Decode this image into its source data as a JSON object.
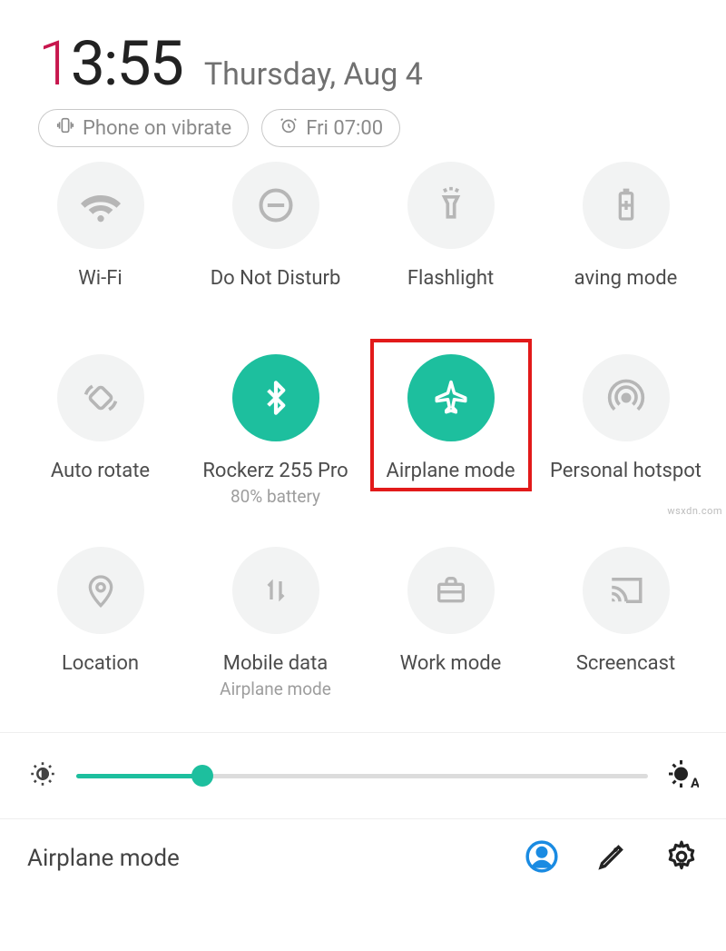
{
  "header": {
    "clock_first": "1",
    "clock_rest": "3:55",
    "date": "Thursday, Aug 4"
  },
  "chips": {
    "vibrate": "Phone on vibrate",
    "alarm": "Fri 07:00"
  },
  "tiles": [
    {
      "id": "wifi",
      "label": "Wi-Fi",
      "sub": "",
      "active": false
    },
    {
      "id": "dnd",
      "label": "Do Not Disturb",
      "sub": "",
      "active": false
    },
    {
      "id": "flashlight",
      "label": "Flashlight",
      "sub": "",
      "active": false
    },
    {
      "id": "saving",
      "label": "aving mode",
      "sub": "",
      "active": false
    },
    {
      "id": "autorotate",
      "label": "Auto rotate",
      "sub": "",
      "active": false
    },
    {
      "id": "bluetooth",
      "label": "Rockerz 255 Pro",
      "sub": "80% battery",
      "active": true
    },
    {
      "id": "airplane",
      "label": "Airplane mode",
      "sub": "",
      "active": true
    },
    {
      "id": "hotspot",
      "label": "Personal hotspot",
      "sub": "",
      "active": false
    },
    {
      "id": "location",
      "label": "Location",
      "sub": "",
      "active": false
    },
    {
      "id": "mobiledata",
      "label": "Mobile data",
      "sub": "Airplane mode",
      "active": false
    },
    {
      "id": "workmode",
      "label": "Work mode",
      "sub": "",
      "active": false
    },
    {
      "id": "screencast",
      "label": "Screencast",
      "sub": "",
      "active": false
    }
  ],
  "highlight_tile": "airplane",
  "brightness": {
    "percent": 22
  },
  "footer": {
    "title": "Airplane mode"
  },
  "colors": {
    "accent": "#1dbf9e",
    "highlight": "#e21a1a",
    "clockFirst": "#c7164d",
    "profile": "#1a8be2"
  },
  "watermark": "wsxdn.com"
}
